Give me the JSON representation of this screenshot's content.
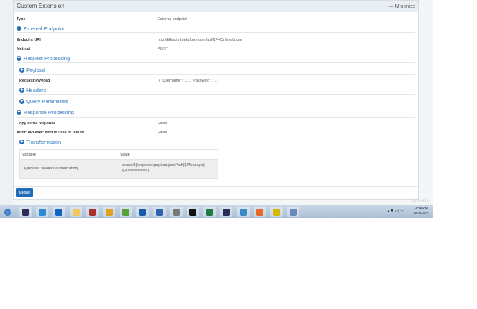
{
  "modal": {
    "title": "Custom Extension",
    "minimize": "Minimize"
  },
  "fields": {
    "type_label": "Type",
    "type_value": "External endpoint",
    "external_endpoint": "External Endpoint",
    "endpoint_uri_label": "Endpoint URI",
    "endpoint_uri_value": "http://kfhapi.rltdplatform.com/api/KFHOnline/Login",
    "method_label": "Method",
    "method_value": "POST",
    "request_processing": "Request Processing",
    "payload": "Payload",
    "request_payload_label": "Request Payload",
    "request_payload_value": "{ \"Username\": \"...\", \"Password\": \"...\" }",
    "headers": "Headers",
    "query_parameters": "Query Parameters",
    "response_processing": "Response Processing",
    "copy_label": "Copy entire response",
    "copy_value": "False",
    "abort_label": "Abort API execution in case of failure",
    "abort_value": "False",
    "transformation": "Transformation"
  },
  "table": {
    "headers": [
      "Variable",
      "Value"
    ],
    "rows": [
      {
        "variable": "${request.headers.authorization}",
        "value_line1": "bearer ${response.payload.jsonPath($.Message)}",
        "value_line2": "${AccessToken}"
      }
    ]
  },
  "close": "Close",
  "watermark": "softwaire",
  "taskbar": {
    "time": "9:34 PM",
    "date": "09/03/2021",
    "colors": [
      "#1e5aa8",
      "#2b2b5c",
      "#2c8ad8",
      "#0b64c0",
      "#f0c85a",
      "#a8322a",
      "#e0a020",
      "#5aa03a",
      "#1a5ab0",
      "#3060b0",
      "#777",
      "#111",
      "#1f7a40",
      "#2b2b5c",
      "#3a88c8",
      "#e86a2a",
      "#d4b800",
      "#6a8ac0"
    ]
  }
}
